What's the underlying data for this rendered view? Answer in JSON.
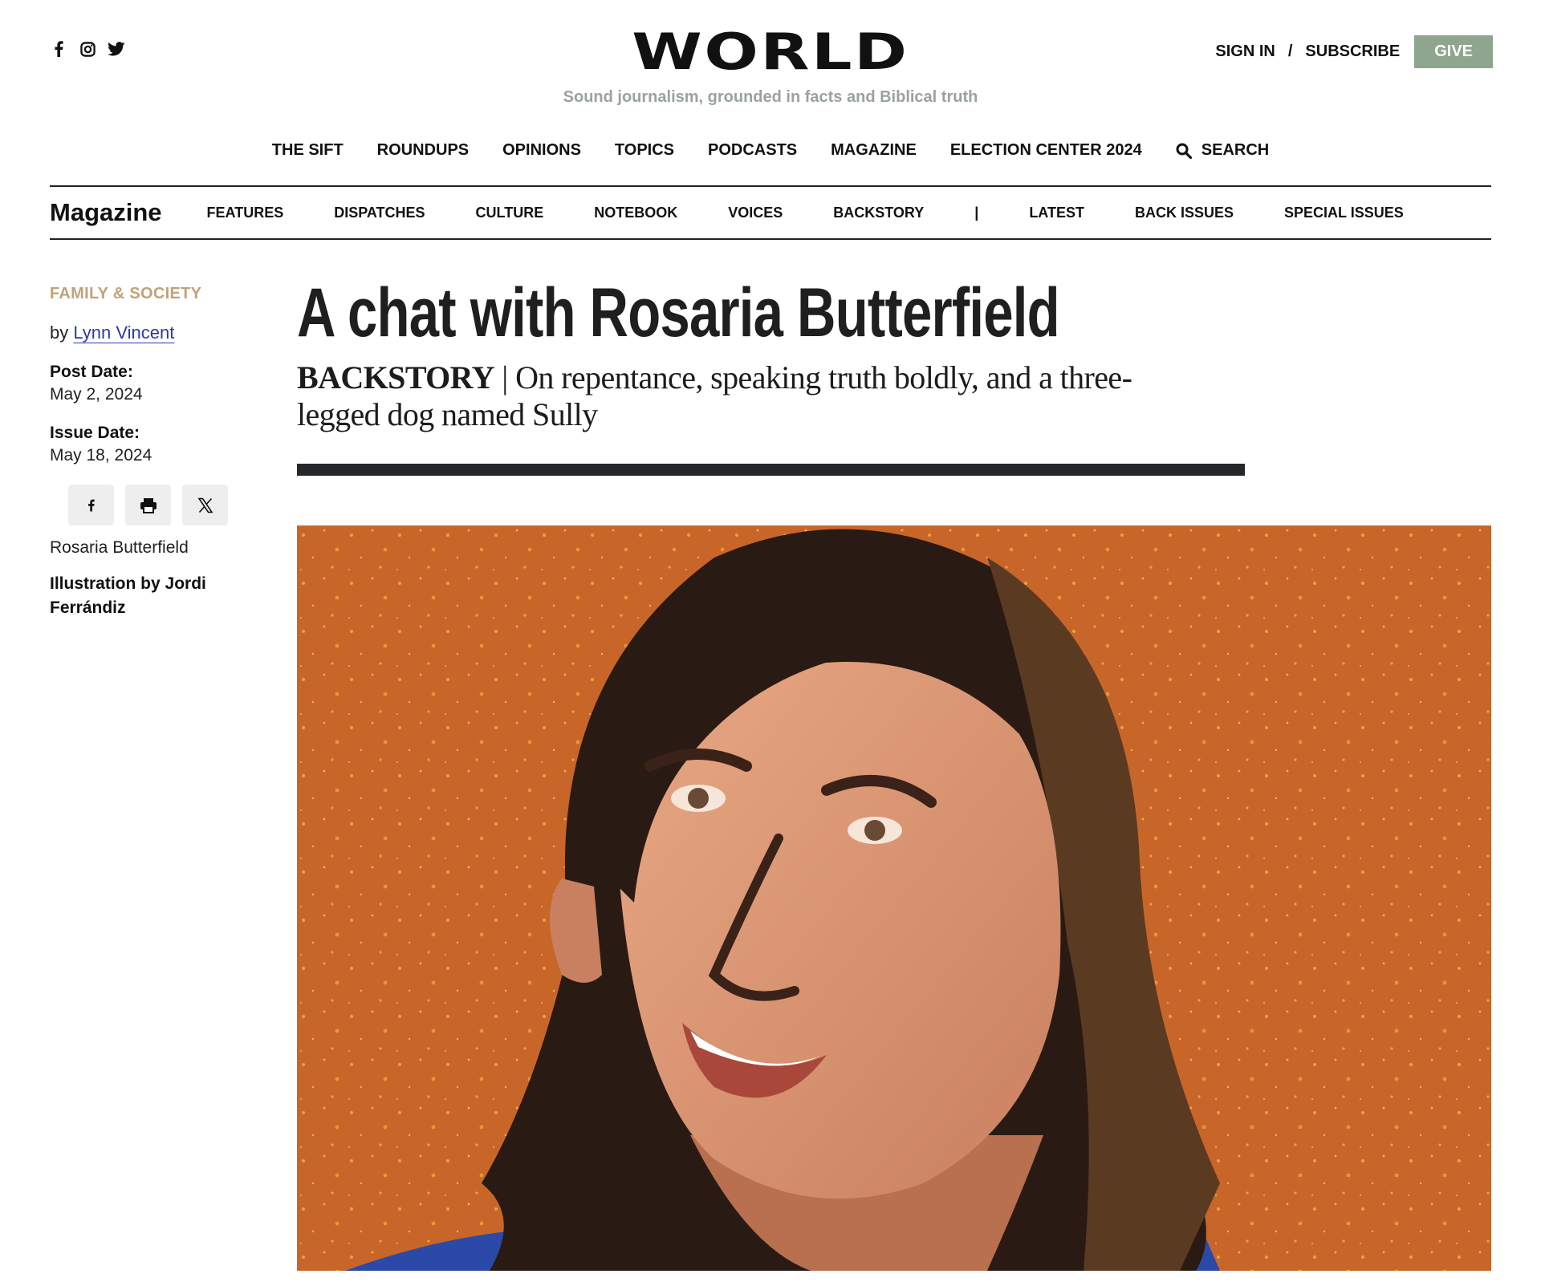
{
  "brand": {
    "logo": "WORLD",
    "tagline": "Sound journalism, grounded in facts and Biblical truth"
  },
  "social": {
    "icons": [
      "facebook-icon",
      "instagram-icon",
      "twitter-icon"
    ]
  },
  "account": {
    "sign_in": "SIGN IN",
    "separator": "/",
    "subscribe": "SUBSCRIBE",
    "give": "GIVE"
  },
  "primary_nav": {
    "items": [
      "THE SIFT",
      "ROUNDUPS",
      "OPINIONS",
      "TOPICS",
      "PODCASTS",
      "MAGAZINE",
      "ELECTION CENTER 2024"
    ],
    "search": "SEARCH"
  },
  "magazine_nav": {
    "title": "Magazine",
    "items": [
      "FEATURES",
      "DISPATCHES",
      "CULTURE",
      "NOTEBOOK",
      "VOICES",
      "BACKSTORY"
    ],
    "divider": "|",
    "items_right": [
      "LATEST",
      "BACK ISSUES",
      "SPECIAL ISSUES"
    ]
  },
  "article": {
    "category": "FAMILY & SOCIETY",
    "by": "by",
    "author": "Lynn Vincent",
    "post_date_label": "Post Date:",
    "post_date": "May 2, 2024",
    "issue_date_label": "Issue Date:",
    "issue_date": "May 18, 2024",
    "headline": "A chat with Rosaria Butterfield",
    "kicker": "BACKSTORY",
    "kicker_sep": " | ",
    "dek": "On repentance, speaking truth boldly, and a three-legged dog named Sully",
    "image_caption": "Rosaria Butterfield",
    "image_credit": "Illustration by Jordi Ferrándiz"
  },
  "share_buttons": [
    "facebook-icon",
    "print-icon",
    "x-icon"
  ],
  "colors": {
    "category": "#c2a17a",
    "give_button": "#8fa58e",
    "tagline": "#9aa39a",
    "author_link": "#2a3aa8",
    "illustration_bg": "#c8662a"
  }
}
